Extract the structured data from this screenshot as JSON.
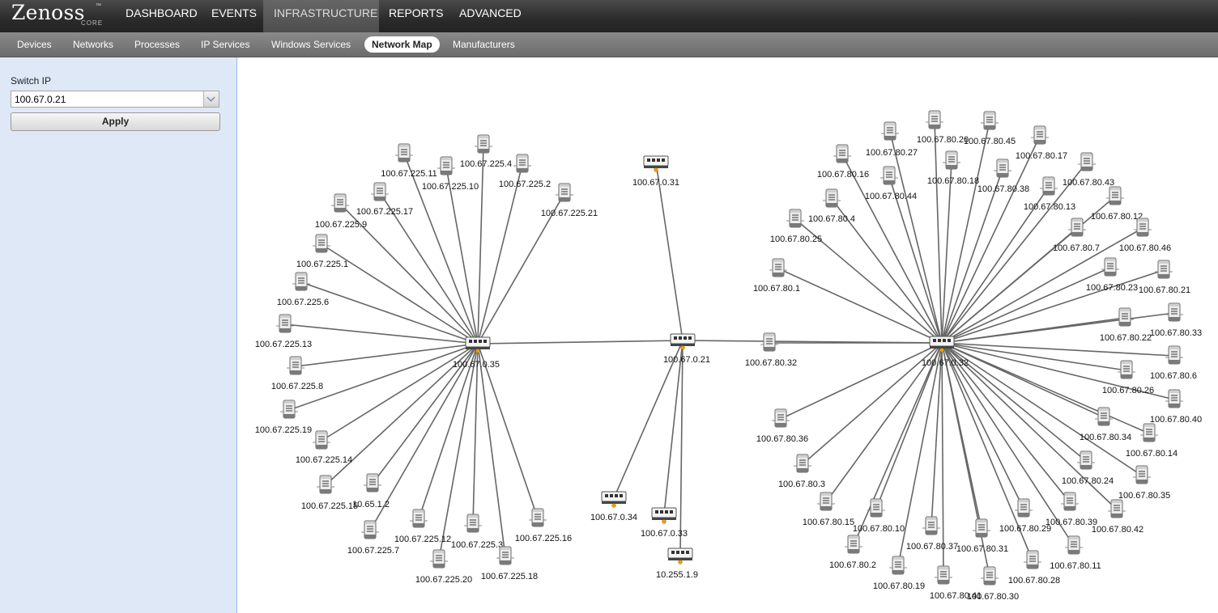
{
  "app": {
    "logo_text": "Zenoss",
    "logo_tm": "™",
    "logo_sub": "CORE"
  },
  "top_nav": [
    {
      "label": "DASHBOARD",
      "active": false
    },
    {
      "label": "EVENTS",
      "active": false
    },
    {
      "label": "INFRASTRUCTURE",
      "active": true
    },
    {
      "label": "REPORTS",
      "active": false
    },
    {
      "label": "ADVANCED",
      "active": false
    }
  ],
  "sub_nav": [
    {
      "label": "Devices",
      "active": false
    },
    {
      "label": "Networks",
      "active": false
    },
    {
      "label": "Processes",
      "active": false
    },
    {
      "label": "IP Services",
      "active": false
    },
    {
      "label": "Windows Services",
      "active": false
    },
    {
      "label": "Network Map",
      "active": true
    },
    {
      "label": "Manufacturers",
      "active": false
    }
  ],
  "left_panel": {
    "switch_ip_label": "Switch IP",
    "switch_ip_value": "100.67.0.21",
    "apply_label": "Apply",
    "dropdown_icon": "chevron-down-icon"
  },
  "colors": {
    "header_bg": "#2b2b2b",
    "subnav_bg": "#7a7a7a",
    "panel_bg": "#dfe8f6",
    "link_line": "#666666",
    "switch_port_dot": "#f0a000"
  },
  "network_map": {
    "icons": {
      "switch": "switch-icon",
      "server": "server-icon"
    },
    "links": [
      [
        "100.67.0.21",
        "100.67.0.35"
      ],
      [
        "100.67.0.21",
        "100.67.0.32"
      ],
      [
        "100.67.0.21",
        "100.67.0.31"
      ],
      [
        "100.67.0.21",
        "100.67.0.34"
      ],
      [
        "100.67.0.21",
        "100.67.0.33"
      ],
      [
        "100.67.0.21",
        "10.255.1.9"
      ]
    ],
    "nodes": [
      {
        "id": "100.67.0.21",
        "label": "100.67.0.21",
        "type": "switch",
        "parent": null
      },
      {
        "id": "100.67.0.35",
        "label": "100.67.0.35",
        "type": "switch",
        "parent": null
      },
      {
        "id": "100.67.0.32",
        "label": "100.67.0.32",
        "type": "switch",
        "parent": null
      },
      {
        "id": "100.67.0.31",
        "label": "100.67.0.31",
        "type": "switch",
        "parent": null
      },
      {
        "id": "100.67.0.34",
        "label": "100.67.0.34",
        "type": "switch",
        "parent": null
      },
      {
        "id": "100.67.0.33",
        "label": "100.67.0.33",
        "type": "switch",
        "parent": null
      },
      {
        "id": "10.255.1.9",
        "label": "10.255.1.9",
        "type": "switch",
        "parent": null
      },
      {
        "id": "100.67.225.11",
        "label": "100.67.225.11",
        "type": "server",
        "parent": "100.67.0.35"
      },
      {
        "id": "100.67.225.10",
        "label": "100.67.225.10",
        "type": "server",
        "parent": "100.67.0.35"
      },
      {
        "id": "100.67.225.4",
        "label": "100.67.225.4",
        "type": "server",
        "parent": "100.67.0.35"
      },
      {
        "id": "100.67.225.2",
        "label": "100.67.225.2",
        "type": "server",
        "parent": "100.67.0.35"
      },
      {
        "id": "100.67.225.21",
        "label": "100.67.225.21",
        "type": "server",
        "parent": "100.67.0.35"
      },
      {
        "id": "100.67.225.17",
        "label": "100.67.225.17",
        "type": "server",
        "parent": "100.67.0.35"
      },
      {
        "id": "100.67.225.9",
        "label": "100.67.225.9",
        "type": "server",
        "parent": "100.67.0.35"
      },
      {
        "id": "100.67.225.1",
        "label": "100.67.225.1",
        "type": "server",
        "parent": "100.67.0.35"
      },
      {
        "id": "100.67.225.6",
        "label": "100.67.225.6",
        "type": "server",
        "parent": "100.67.0.35"
      },
      {
        "id": "100.67.225.13",
        "label": "100.67.225.13",
        "type": "server",
        "parent": "100.67.0.35"
      },
      {
        "id": "100.67.225.8",
        "label": "100.67.225.8",
        "type": "server",
        "parent": "100.67.0.35"
      },
      {
        "id": "100.67.225.19",
        "label": "100.67.225.19",
        "type": "server",
        "parent": "100.67.0.35"
      },
      {
        "id": "100.67.225.14",
        "label": "100.67.225.14",
        "type": "server",
        "parent": "100.67.0.35"
      },
      {
        "id": "100.67.225.15",
        "label": "100.67.225.15",
        "type": "server",
        "parent": "100.67.0.35"
      },
      {
        "id": "10.65.1.2",
        "label": "10.65.1.2",
        "type": "server",
        "parent": "100.67.0.35"
      },
      {
        "id": "100.67.225.7",
        "label": "100.67.225.7",
        "type": "server",
        "parent": "100.67.0.35"
      },
      {
        "id": "100.67.225.12",
        "label": "100.67.225.12",
        "type": "server",
        "parent": "100.67.0.35"
      },
      {
        "id": "100.67.225.3",
        "label": "100.67.225.3",
        "type": "server",
        "parent": "100.67.0.35"
      },
      {
        "id": "100.67.225.16",
        "label": "100.67.225.16",
        "type": "server",
        "parent": "100.67.0.35"
      },
      {
        "id": "100.67.225.20",
        "label": "100.67.225.20",
        "type": "server",
        "parent": "100.67.0.35"
      },
      {
        "id": "100.67.225.18",
        "label": "100.67.225.18",
        "type": "server",
        "parent": "100.67.0.35"
      },
      {
        "id": "100.67.80.27",
        "label": "100.67.80.27",
        "type": "server",
        "parent": "100.67.0.32"
      },
      {
        "id": "100.67.80.20",
        "label": "100.67.80.20",
        "type": "server",
        "parent": "100.67.0.32"
      },
      {
        "id": "100.67.80.45",
        "label": "100.67.80.45",
        "type": "server",
        "parent": "100.67.0.32"
      },
      {
        "id": "100.67.80.17",
        "label": "100.67.80.17",
        "type": "server",
        "parent": "100.67.0.32"
      },
      {
        "id": "100.67.80.16",
        "label": "100.67.80.16",
        "type": "server",
        "parent": "100.67.0.32"
      },
      {
        "id": "100.67.80.18",
        "label": "100.67.80.18",
        "type": "server",
        "parent": "100.67.0.32"
      },
      {
        "id": "100.67.80.44",
        "label": "100.67.80.44",
        "type": "server",
        "parent": "100.67.0.32"
      },
      {
        "id": "100.67.80.38",
        "label": "100.67.80.38",
        "type": "server",
        "parent": "100.67.0.32"
      },
      {
        "id": "100.67.80.43",
        "label": "100.67.80.43",
        "type": "server",
        "parent": "100.67.0.32"
      },
      {
        "id": "100.67.80.13",
        "label": "100.67.80.13",
        "type": "server",
        "parent": "100.67.0.32"
      },
      {
        "id": "100.67.80.4",
        "label": "100.67.80.4",
        "type": "server",
        "parent": "100.67.0.32"
      },
      {
        "id": "100.67.80.12",
        "label": "100.67.80.12",
        "type": "server",
        "parent": "100.67.0.32"
      },
      {
        "id": "100.67.80.25",
        "label": "100.67.80.25",
        "type": "server",
        "parent": "100.67.0.32"
      },
      {
        "id": "100.67.80.7",
        "label": "100.67.80.7",
        "type": "server",
        "parent": "100.67.0.32"
      },
      {
        "id": "100.67.80.46",
        "label": "100.67.80.46",
        "type": "server",
        "parent": "100.67.0.32"
      },
      {
        "id": "100.67.80.1",
        "label": "100.67.80.1",
        "type": "server",
        "parent": "100.67.0.32"
      },
      {
        "id": "100.67.80.23",
        "label": "100.67.80.23",
        "type": "server",
        "parent": "100.67.0.32"
      },
      {
        "id": "100.67.80.21",
        "label": "100.67.80.21",
        "type": "server",
        "parent": "100.67.0.32"
      },
      {
        "id": "100.67.80.33",
        "label": "100.67.80.33",
        "type": "server",
        "parent": "100.67.0.32"
      },
      {
        "id": "100.67.80.22",
        "label": "100.67.80.22",
        "type": "server",
        "parent": "100.67.0.32"
      },
      {
        "id": "100.67.80.32",
        "label": "100.67.80.32",
        "type": "server",
        "parent": "100.67.0.32"
      },
      {
        "id": "100.67.80.6",
        "label": "100.67.80.6",
        "type": "server",
        "parent": "100.67.0.32"
      },
      {
        "id": "100.67.80.26",
        "label": "100.67.80.26",
        "type": "server",
        "parent": "100.67.0.32"
      },
      {
        "id": "100.67.80.40",
        "label": "100.67.80.40",
        "type": "server",
        "parent": "100.67.0.32"
      },
      {
        "id": "100.67.80.36",
        "label": "100.67.80.36",
        "type": "server",
        "parent": "100.67.0.32"
      },
      {
        "id": "100.67.80.34",
        "label": "100.67.80.34",
        "type": "server",
        "parent": "100.67.0.32"
      },
      {
        "id": "100.67.80.14",
        "label": "100.67.80.14",
        "type": "server",
        "parent": "100.67.0.32"
      },
      {
        "id": "100.67.80.3",
        "label": "100.67.80.3",
        "type": "server",
        "parent": "100.67.0.32"
      },
      {
        "id": "100.67.80.24",
        "label": "100.67.80.24",
        "type": "server",
        "parent": "100.67.0.32"
      },
      {
        "id": "100.67.80.35",
        "label": "100.67.80.35",
        "type": "server",
        "parent": "100.67.0.32"
      },
      {
        "id": "100.67.80.15",
        "label": "100.67.80.15",
        "type": "server",
        "parent": "100.67.0.32"
      },
      {
        "id": "100.67.80.10",
        "label": "100.67.80.10",
        "type": "server",
        "parent": "100.67.0.32"
      },
      {
        "id": "100.67.80.37",
        "label": "100.67.80.37",
        "type": "server",
        "parent": "100.67.0.32"
      },
      {
        "id": "100.67.80.31",
        "label": "100.67.80.31",
        "type": "server",
        "parent": "100.67.0.32"
      },
      {
        "id": "100.67.80.29",
        "label": "100.67.80.29",
        "type": "server",
        "parent": "100.67.0.32"
      },
      {
        "id": "100.67.80.39",
        "label": "100.67.80.39",
        "type": "server",
        "parent": "100.67.0.32"
      },
      {
        "id": "100.67.80.42",
        "label": "100.67.80.42",
        "type": "server",
        "parent": "100.67.0.32"
      },
      {
        "id": "100.67.80.2",
        "label": "100.67.80.2",
        "type": "server",
        "parent": "100.67.0.32"
      },
      {
        "id": "100.67.80.19",
        "label": "100.67.80.19",
        "type": "server",
        "parent": "100.67.0.32"
      },
      {
        "id": "100.67.80.41",
        "label": "100.67.80.41",
        "type": "server",
        "parent": "100.67.0.32"
      },
      {
        "id": "100.67.80.30",
        "label": "100.67.80.30",
        "type": "server",
        "parent": "100.67.0.32"
      },
      {
        "id": "100.67.80.28",
        "label": "100.67.80.28",
        "type": "server",
        "parent": "100.67.0.32"
      },
      {
        "id": "100.67.80.11",
        "label": "100.67.80.11",
        "type": "server",
        "parent": "100.67.0.32"
      }
    ]
  }
}
